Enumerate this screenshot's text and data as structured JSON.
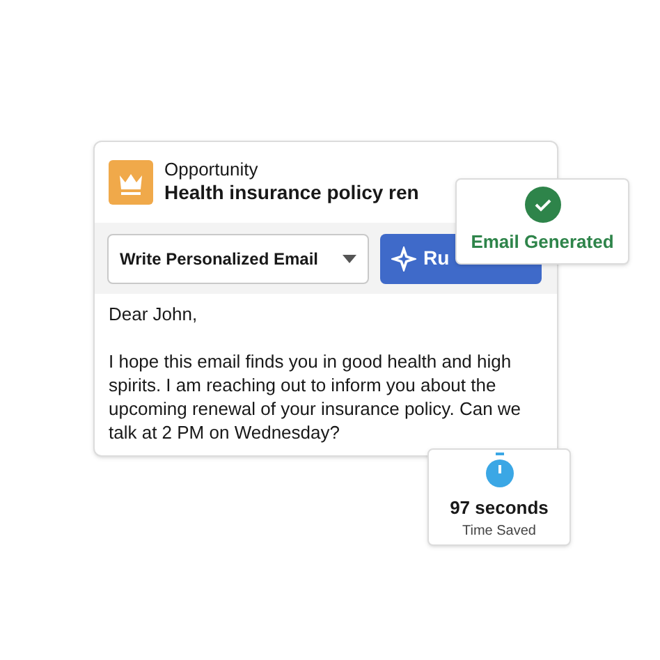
{
  "record": {
    "type_label": "Opportunity",
    "title": "Health insurance policy ren"
  },
  "toolbar": {
    "dropdown": "Write Personalized Email",
    "button": "Ru"
  },
  "email": {
    "greeting": "Dear John,",
    "body": "I hope this email finds you in good health and high spirits. I am reaching out to inform you about the upcoming renewal of your insurance policy. Can we talk at 2 PM on Wednesday?"
  },
  "status_card": {
    "label": "Email Generated"
  },
  "stat_card": {
    "value": "97 seconds",
    "caption": "Time Saved"
  }
}
